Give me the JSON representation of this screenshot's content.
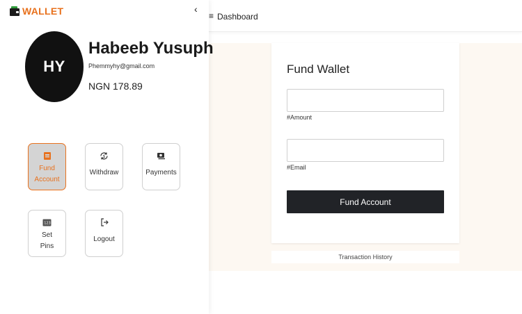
{
  "brand": {
    "name": "WALLET",
    "accent": "#e8711d"
  },
  "sidebar": {
    "collapse_glyph": "‹",
    "profile": {
      "initials": "HY",
      "name": "Habeeb Yusuph",
      "email": "Phemmyhy@gmail.com",
      "balance": "NGN 178.89"
    },
    "actions": [
      {
        "label_line1": "Fund",
        "label_line2": "Account",
        "icon": "wallet-icon",
        "active": true
      },
      {
        "label": "Withdraw",
        "icon": "withdraw-icon",
        "active": false
      },
      {
        "label": "Payments",
        "icon": "payments-icon",
        "active": false
      },
      {
        "label_line1": "Set",
        "label_line2": "Pins",
        "icon": "pin-pad-icon",
        "active": false
      },
      {
        "label": "Logout",
        "icon": "logout-icon",
        "active": false
      }
    ]
  },
  "header": {
    "menu_glyph": "≡",
    "breadcrumb": "Dashboard"
  },
  "fund_form": {
    "title": "Fund Wallet",
    "amount": {
      "value": "",
      "hint": "#Amount"
    },
    "email": {
      "value": "",
      "hint": "#Email"
    },
    "submit_label": "Fund Account"
  },
  "history_link": "Transaction History",
  "colors": {
    "button_dark": "#212327",
    "content_bg": "#fdf8f2",
    "tile_active_bg": "#d4d4d4"
  }
}
